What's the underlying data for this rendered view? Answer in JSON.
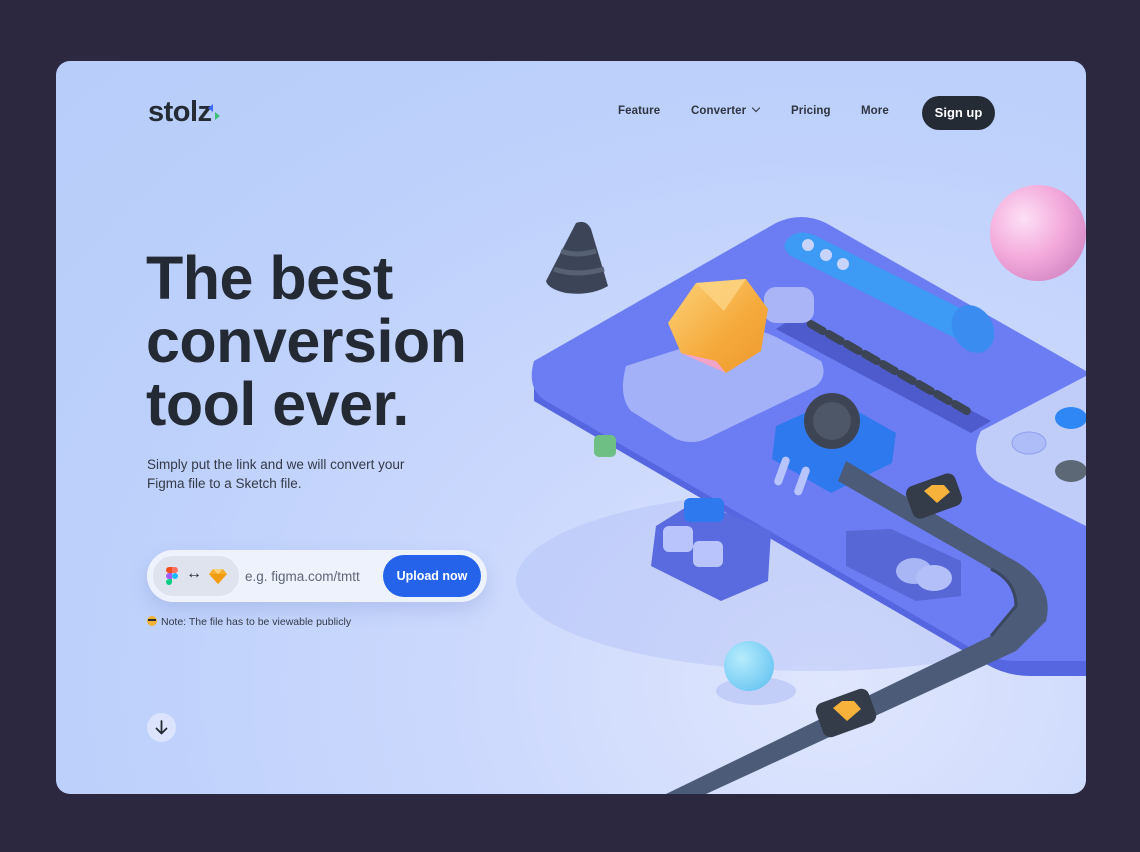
{
  "brand": {
    "logo_text": "stolz",
    "accent_blue": "#3f6cf6",
    "accent_green": "#3fbf76"
  },
  "nav": {
    "items": [
      {
        "label": "Feature"
      },
      {
        "label": "Converter",
        "has_dropdown": true
      },
      {
        "label": "Pricing"
      },
      {
        "label": "More"
      }
    ],
    "signup_label": "Sign up"
  },
  "hero": {
    "title_lines": [
      "The best",
      "conversion",
      "tool ever."
    ],
    "subtitle": "Simply put the link and we will convert your Figma file to a Sketch file."
  },
  "converter": {
    "from_icon": "figma-icon",
    "swap_icon": "swap-arrows-icon",
    "swap_glyph": "↔",
    "to_icon": "sketch-icon",
    "url_value": "",
    "url_placeholder": "e.g. figma.com/tmtt",
    "upload_label": "Upload now",
    "button_color": "#2563eb"
  },
  "note": {
    "icon": "sunglasses-emoji-icon",
    "text": "Note: The file has to be viewable publicly"
  },
  "scroll_down_icon": "arrow-down-icon",
  "illustration": {
    "description": "3D isometric conversion machine with gem input, conveyor belt outputting Sketch icons",
    "colors": {
      "machine": "#6b7cf0",
      "belt": "#4a5a78",
      "gem": "#f7b23b",
      "sphere_pink": "#f6b3e0",
      "sphere_blue": "#8edaf7",
      "cone": "#3d4657"
    }
  }
}
